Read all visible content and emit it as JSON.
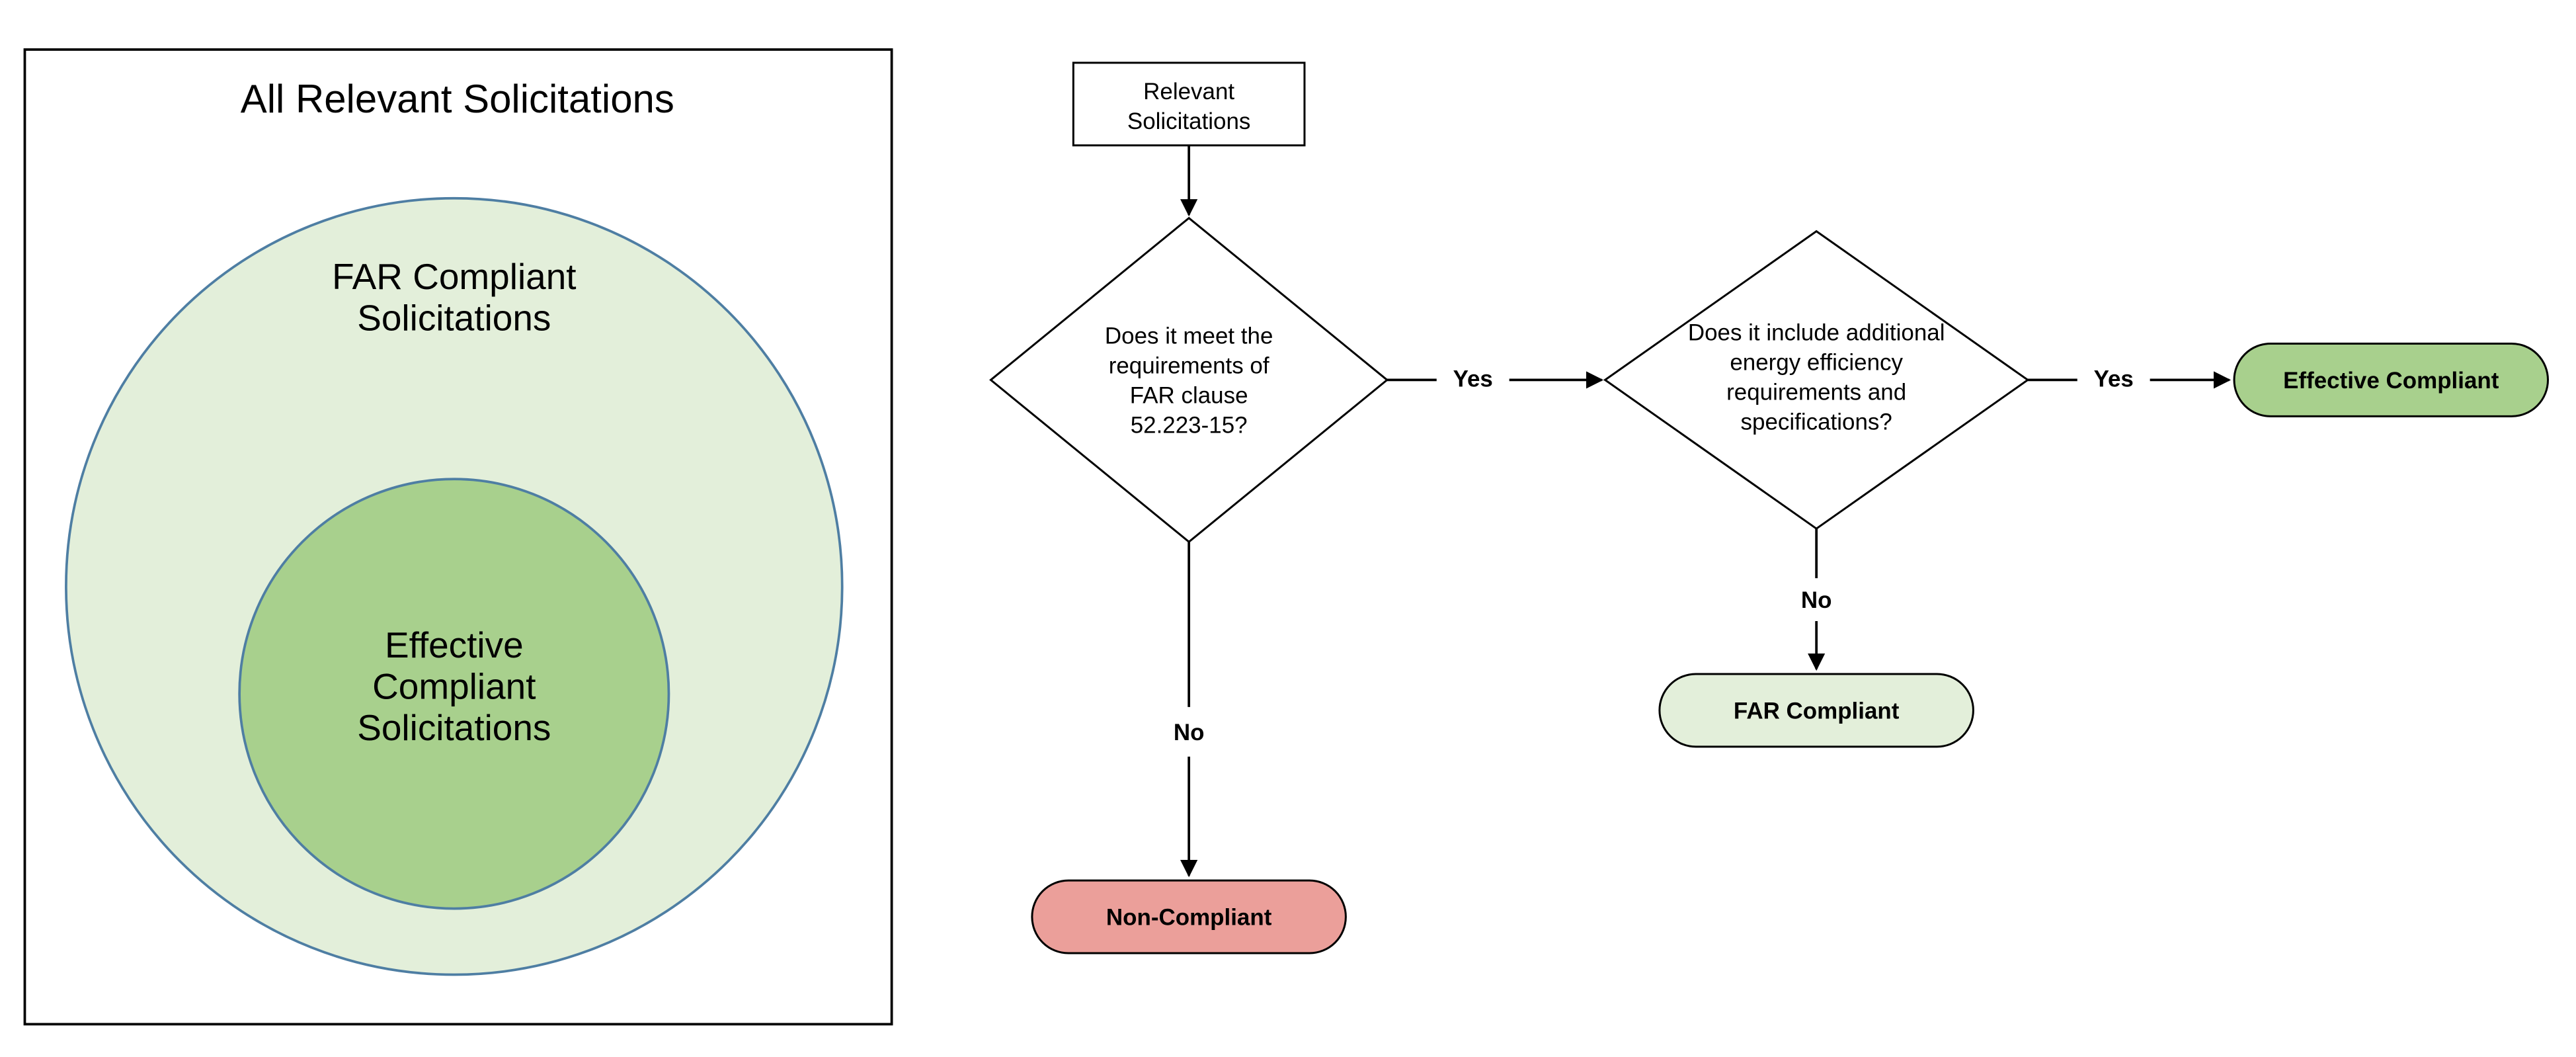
{
  "venn": {
    "outer_box_label": "All Relevant Solicitations",
    "outer_circle_label_l1": "FAR Compliant",
    "outer_circle_label_l2": "Solicitations",
    "inner_circle_label_l1": "Effective",
    "inner_circle_label_l2": "Compliant",
    "inner_circle_label_l3": "Solicitations"
  },
  "flow": {
    "start_l1": "Relevant",
    "start_l2": "Solicitations",
    "decision1_l1": "Does it meet the",
    "decision1_l2": "requirements of",
    "decision1_l3": "FAR clause",
    "decision1_l4": "52.223-15?",
    "decision2_l1": "Does it include additional",
    "decision2_l2": "energy efficiency",
    "decision2_l3": "requirements and",
    "decision2_l4": "specifications?",
    "yes": "Yes",
    "no": "No",
    "term_noncompliant": "Non-Compliant",
    "term_far": "FAR Compliant",
    "term_effective": "Effective Compliant"
  },
  "colors": {
    "light_green": "#e3efda",
    "mid_green": "#a8d08d",
    "dark_green_fill": "#a8d08d",
    "red": "#eb9f9a",
    "circle_stroke": "#4e7ea3",
    "black": "#000000"
  }
}
